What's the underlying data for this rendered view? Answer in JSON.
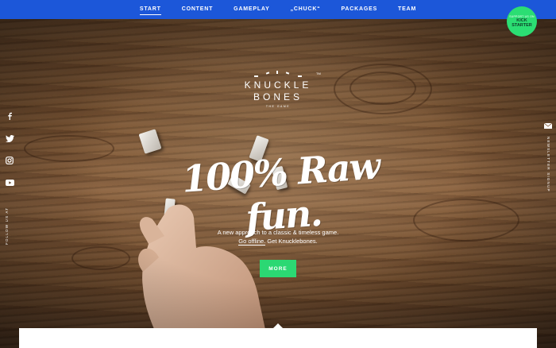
{
  "nav": {
    "items": [
      {
        "label": "START",
        "active": true
      },
      {
        "label": "CONTENT",
        "active": false
      },
      {
        "label": "GAMEPLAY",
        "active": false
      },
      {
        "label": "„CHUCK“",
        "active": false
      },
      {
        "label": "PACKAGES",
        "active": false
      },
      {
        "label": "TEAM",
        "active": false
      }
    ],
    "color": "#1c57d9"
  },
  "kickstarter": {
    "line1": "SUPPORT US ON",
    "line2": "KICK",
    "line3": "STARTER",
    "color": "#2bde73"
  },
  "logo": {
    "line1": "KNUCKLE",
    "line2": "BONES",
    "tm": "TM",
    "subtitle": "THE GAME"
  },
  "hero": {
    "headline": "100% Raw fun.",
    "tagline_line1": "A new approach to a classic & timeless game.",
    "tagline_link": "Go offline.",
    "tagline_rest": " Get Knucklebones.",
    "more_label": "MORE",
    "more_color": "#2bd873"
  },
  "social": {
    "icons": [
      "facebook-icon",
      "twitter-icon",
      "instagram-icon",
      "youtube-icon"
    ],
    "follow_label": "FOLLOW US AT"
  },
  "newsletter": {
    "icon": "mail-icon",
    "label": "NEWSLETTER SIGNUP"
  }
}
